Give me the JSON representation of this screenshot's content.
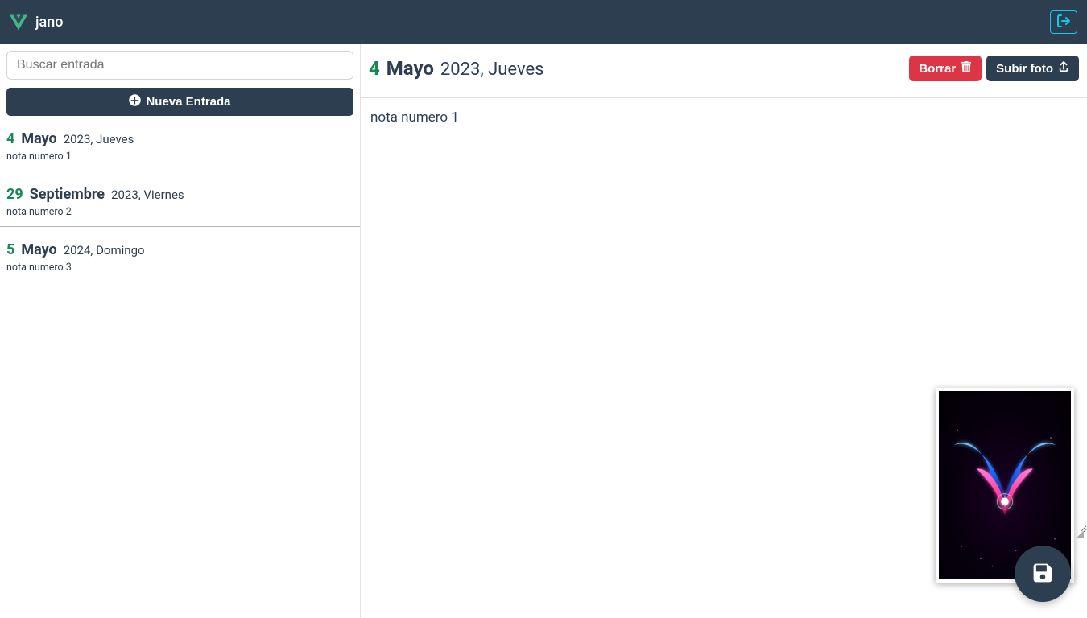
{
  "navbar": {
    "appname": "jano"
  },
  "sidebar": {
    "search_placeholder": "Buscar entrada",
    "new_entry_label": "Nueva Entrada",
    "entries": [
      {
        "day": "4",
        "month": "Mayo",
        "rest": "2023, Jueves",
        "preview": "nota numero 1"
      },
      {
        "day": "29",
        "month": "Septiembre",
        "rest": "2023, Viernes",
        "preview": "nota numero 2"
      },
      {
        "day": "5",
        "month": "Mayo",
        "rest": "2024, Domingo",
        "preview": "nota numero 3"
      }
    ]
  },
  "detail": {
    "day": "4",
    "month": "Mayo",
    "rest": "2023, Jueves",
    "delete_label": "Borrar",
    "upload_label": "Subir foto",
    "note_text": "nota numero 1"
  }
}
